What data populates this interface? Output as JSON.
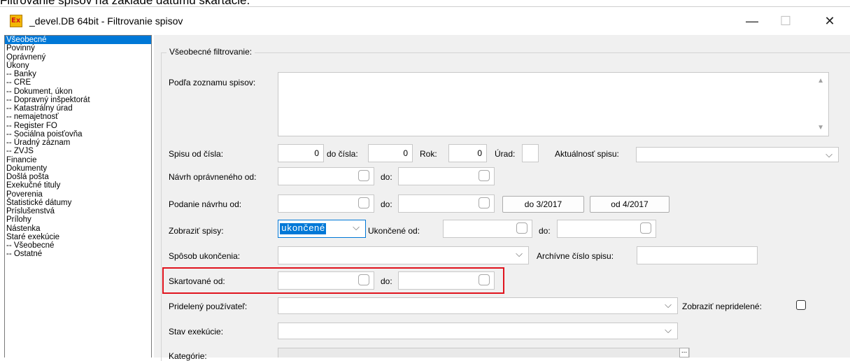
{
  "caption": "Filtrovanie spisov na základe dátumu skartácie.",
  "window": {
    "title": "_devel.DB 64bit - Filtrovanie spisov",
    "icon_label": "Ex",
    "minimize": "—",
    "maximize": "☐",
    "close": "✕"
  },
  "sidebar": {
    "items": [
      {
        "label": "Všeobecné",
        "selected": true
      },
      {
        "label": "Povinný"
      },
      {
        "label": "Oprávnený"
      },
      {
        "label": "Úkony"
      },
      {
        "label": "-- Banky"
      },
      {
        "label": "-- CRE"
      },
      {
        "label": "-- Dokument, úkon"
      },
      {
        "label": "-- Dopravný inšpektorát"
      },
      {
        "label": "-- Katastrálny úrad"
      },
      {
        "label": "-- nemajetnosť"
      },
      {
        "label": "-- Register FO"
      },
      {
        "label": "-- Sociálna poisťovňa"
      },
      {
        "label": "-- Úradný záznam"
      },
      {
        "label": "-- ZVJS"
      },
      {
        "label": "Financie"
      },
      {
        "label": "Dokumenty"
      },
      {
        "label": "Došlá pošta"
      },
      {
        "label": "Exekučné tituly"
      },
      {
        "label": "Poverenia"
      },
      {
        "label": "Štatistické dátumy"
      },
      {
        "label": "Príslušenstvá"
      },
      {
        "label": "Prílohy"
      },
      {
        "label": "Nástenka"
      },
      {
        "label": "Staré exekúcie"
      },
      {
        "label": "-- Všeobecné"
      },
      {
        "label": "-- Ostatné"
      }
    ]
  },
  "form": {
    "group_title": "Všeobecné filtrovanie:",
    "list_label": "Podľa zoznamu spisov:",
    "spis_od_label": "Spisu od čísla:",
    "spis_od_value": "0",
    "do_cisla_label": "do čísla:",
    "do_cisla_value": "0",
    "rok_label": "Rok:",
    "rok_value": "0",
    "urad_label": "Úrad:",
    "aktualnost_label": "Aktuálnosť spisu:",
    "navrh_label": "Návrh oprávneného od:",
    "do_label": "do:",
    "podanie_label": "Podanie návrhu od:",
    "btn_do_2017": "do 3/2017",
    "btn_od_2017": "od 4/2017",
    "zobrazit_label": "Zobraziť spisy:",
    "zobrazit_value": "ukončené",
    "ukoncene_od_label": "Ukončené od:",
    "sposob_label": "Spôsob ukončenia:",
    "archivne_label": "Archívne číslo spisu:",
    "skartovane_label": "Skartované od:",
    "pridelany_label": "Pridelený používateľ:",
    "nepridelene_label": "Zobraziť nepridelené:",
    "stav_label": "Stav exekúcie:",
    "kategorie_label": "Kategórie:",
    "ellipsis": "..."
  }
}
